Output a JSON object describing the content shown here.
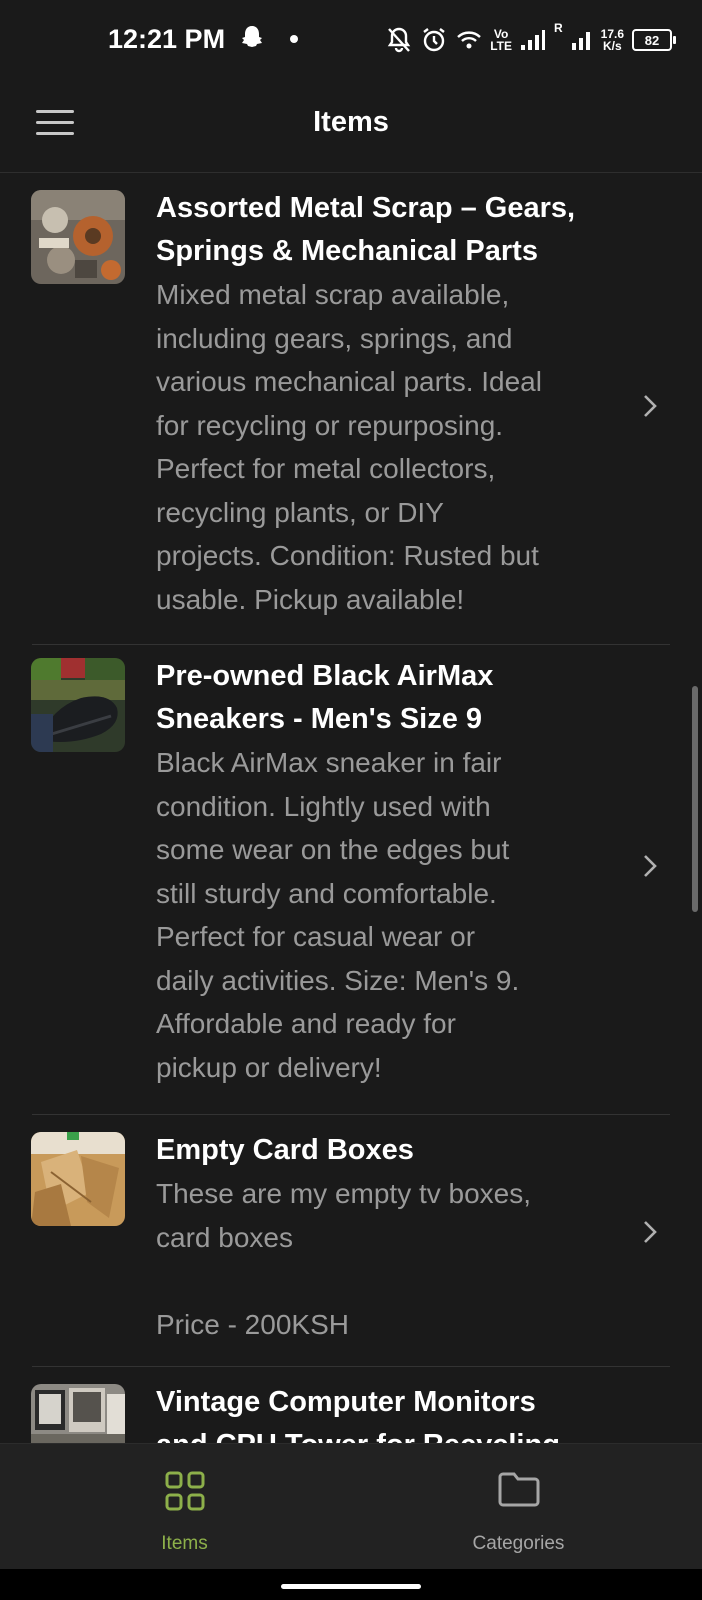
{
  "status_bar": {
    "time": "12:21 PM",
    "network_top": "Vo",
    "network_bottom": "LTE",
    "signal_label": "R",
    "speed_value": "17.6",
    "speed_unit": "K/s",
    "battery": "82",
    "icons": [
      "snapchat-icon",
      "bell-off-icon",
      "alarm-icon",
      "wifi-icon",
      "signal-icon",
      "battery-icon"
    ]
  },
  "app_bar": {
    "title": "Items",
    "menu_icon": "hamburger-menu-icon"
  },
  "items": [
    {
      "title_lines": [
        "Assorted Metal Scrap – Gears,",
        "Springs & Mechanical Parts"
      ],
      "desc_lines": [
        "Mixed metal scrap available,",
        "including gears, springs, and",
        "various mechanical parts. Ideal",
        "for recycling or repurposing.",
        "Perfect for metal collectors,",
        "recycling plants, or DIY",
        "projects. Condition: Rusted but",
        "usable. Pickup available!"
      ],
      "thumb": "metal-scrap-photo"
    },
    {
      "title_lines": [
        "Pre-owned Black AirMax",
        "Sneakers - Men's Size 9"
      ],
      "desc_lines": [
        "Black AirMax sneaker in fair",
        "condition. Lightly used with",
        "some wear on the edges but",
        "still sturdy and comfortable.",
        "Perfect for casual wear or",
        "daily activities. Size: Men's 9.",
        "Affordable and ready for",
        "pickup or delivery!"
      ],
      "thumb": "sneaker-photo"
    },
    {
      "title_lines": [
        "Empty Card Boxes"
      ],
      "desc_lines": [
        "These are my empty tv boxes,",
        "card boxes",
        "",
        "Price - 200KSH"
      ],
      "thumb": "cardboard-boxes-photo"
    },
    {
      "title_lines": [
        "Vintage Computer Monitors",
        "and CPU Tower for Recycling"
      ],
      "desc_lines": [],
      "thumb": "computer-monitors-photo"
    }
  ],
  "bottom_nav": {
    "items": [
      {
        "label": "Items",
        "icon": "grid-icon",
        "active": true
      },
      {
        "label": "Categories",
        "icon": "folder-icon",
        "active": false
      }
    ],
    "active_color": "#8db04a",
    "inactive_color": "#a6a6a6"
  }
}
